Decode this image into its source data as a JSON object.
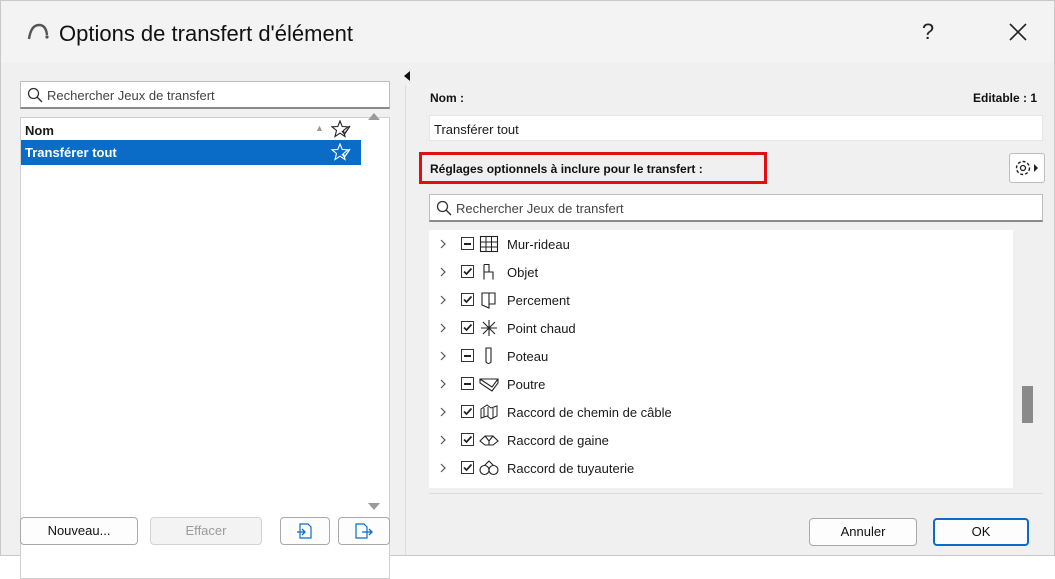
{
  "window": {
    "title": "Options de transfert d'élément",
    "help_label": "?"
  },
  "left": {
    "search_placeholder": "Rechercher Jeux de transfert",
    "column_header": "Nom",
    "items": [
      {
        "label": "Transférer tout",
        "selected": true
      }
    ],
    "buttons": {
      "new": "Nouveau...",
      "delete": "Effacer"
    }
  },
  "right": {
    "name_label": "Nom :",
    "editable_label": "Editable : 1",
    "name_value": "Transférer tout",
    "options_label": "Réglages optionnels à inclure pour le transfert :",
    "search_placeholder": "Rechercher Jeux de transfert",
    "tree_items": [
      {
        "label": "Mur-rideau",
        "state": "partial",
        "icon": "curtain-wall-icon"
      },
      {
        "label": "Objet",
        "state": "checked",
        "icon": "object-chair-icon"
      },
      {
        "label": "Percement",
        "state": "checked",
        "icon": "opening-icon"
      },
      {
        "label": "Point chaud",
        "state": "checked",
        "icon": "hotspot-icon"
      },
      {
        "label": "Poteau",
        "state": "partial",
        "icon": "column-icon"
      },
      {
        "label": "Poutre",
        "state": "partial",
        "icon": "beam-icon"
      },
      {
        "label": "Raccord de chemin de câble",
        "state": "checked",
        "icon": "cable-carrier-fitting-icon"
      },
      {
        "label": "Raccord de gaine",
        "state": "checked",
        "icon": "duct-fitting-icon"
      },
      {
        "label": "Raccord de tuyauterie",
        "state": "checked",
        "icon": "pipe-fitting-icon"
      }
    ]
  },
  "footer": {
    "cancel": "Annuler",
    "ok": "OK"
  },
  "colors": {
    "selection": "#0a6cc7",
    "highlight_border": "#e01010"
  }
}
